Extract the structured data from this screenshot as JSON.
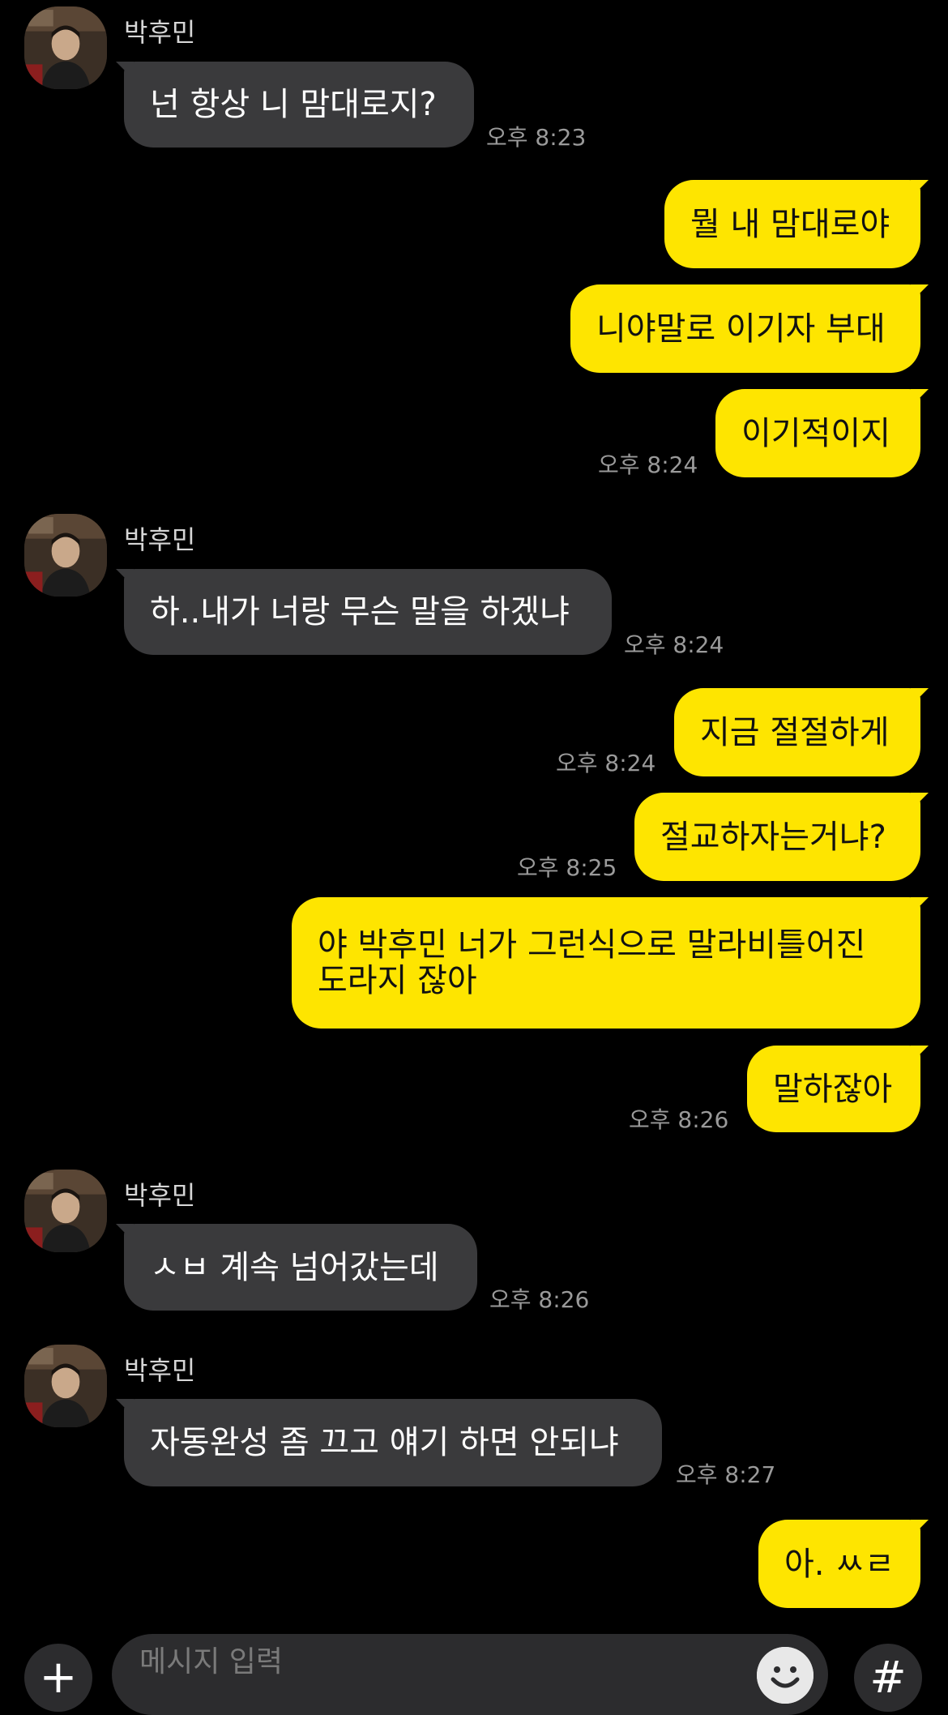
{
  "contact": {
    "name": "박후민"
  },
  "messages": [
    {
      "id": "m1",
      "direction": "in",
      "text": "넌 항상 니 맘대로지?",
      "time": "오후 8:23"
    },
    {
      "id": "m2",
      "direction": "out",
      "text": "뭘 내 맘대로야"
    },
    {
      "id": "m3",
      "direction": "out",
      "text": "니야말로 이기자 부대"
    },
    {
      "id": "m4",
      "direction": "out",
      "text": "이기적이지",
      "time": "오후 8:24"
    },
    {
      "id": "m5",
      "direction": "in",
      "text": "하..내가 너랑 무슨 말을 하겠냐",
      "time": "오후 8:24"
    },
    {
      "id": "m6",
      "direction": "out",
      "text": "지금 절절하게",
      "time": "오후 8:24"
    },
    {
      "id": "m7",
      "direction": "out",
      "text": "절교하자는거냐?",
      "time": "오후 8:25"
    },
    {
      "id": "m8",
      "direction": "out",
      "text": "야 박후민 너가 그런식으로 말라비틀어진 도라지 잖아"
    },
    {
      "id": "m9",
      "direction": "out",
      "text": "말하잖아",
      "time": "오후 8:26"
    },
    {
      "id": "m10",
      "direction": "in",
      "text": "ㅅㅂ 계속 넘어갔는데",
      "time": "오후 8:26"
    },
    {
      "id": "m11",
      "direction": "in",
      "text": "자동완성 좀 끄고 얘기 하면 안되냐",
      "time": "오후 8:27"
    },
    {
      "id": "m12",
      "direction": "out",
      "text": "아. ㅆㄹ"
    }
  ],
  "composer": {
    "placeholder": "메시지 입력",
    "plus_label": "+",
    "hash_label": "#"
  },
  "icons": {
    "plus": "plus-icon",
    "emoji": "emoji-icon",
    "hash": "hashtag-icon"
  },
  "colors": {
    "background": "#000000",
    "incoming_bubble": "#3a3a3c",
    "outgoing_bubble": "#fee500",
    "timestamp": "#9a9a9a"
  }
}
